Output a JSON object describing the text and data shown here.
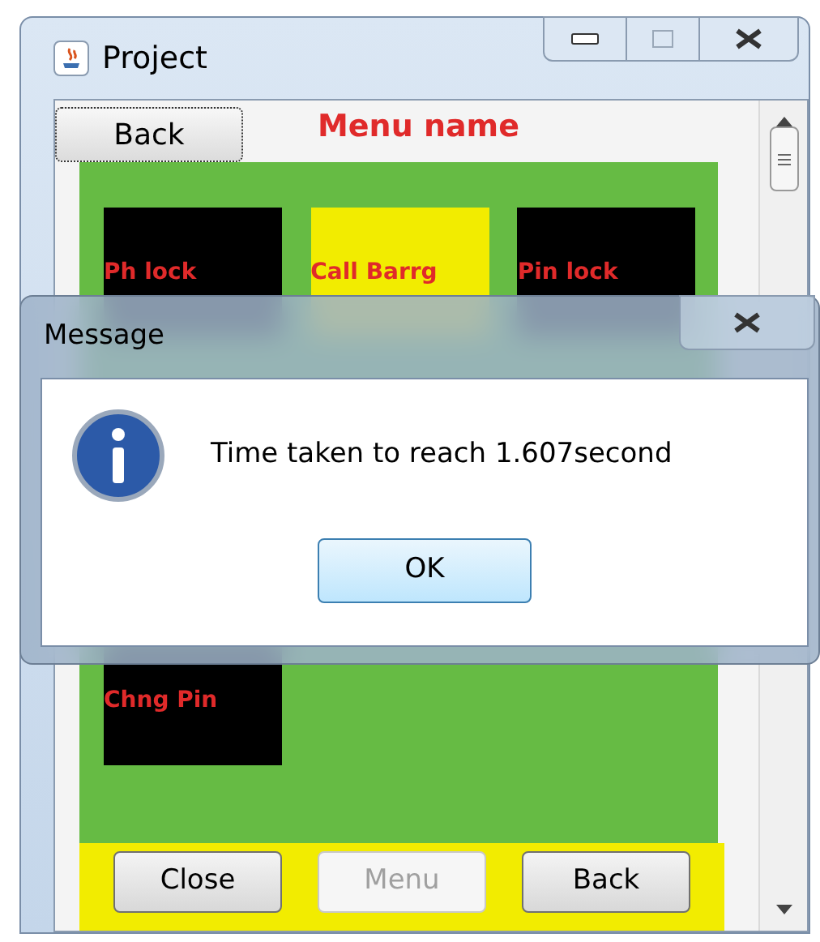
{
  "window": {
    "title": "Project"
  },
  "header": {
    "back_button": "Back",
    "menu_name": "Menu name"
  },
  "tiles": [
    {
      "label": "Ph lock",
      "color": "#000000"
    },
    {
      "label": "Call Barrg",
      "color": "#f2ec00"
    },
    {
      "label": "Pin lock",
      "color": "#000000"
    },
    {
      "label": "Chng Pin",
      "color": "#000000"
    }
  ],
  "bottom_buttons": [
    {
      "label": "Close",
      "disabled": false
    },
    {
      "label": "Menu",
      "disabled": true
    },
    {
      "label": "Back",
      "disabled": false
    }
  ],
  "dialog": {
    "title": "Message",
    "message": "Time taken to reach 1.607second",
    "button": "OK"
  }
}
